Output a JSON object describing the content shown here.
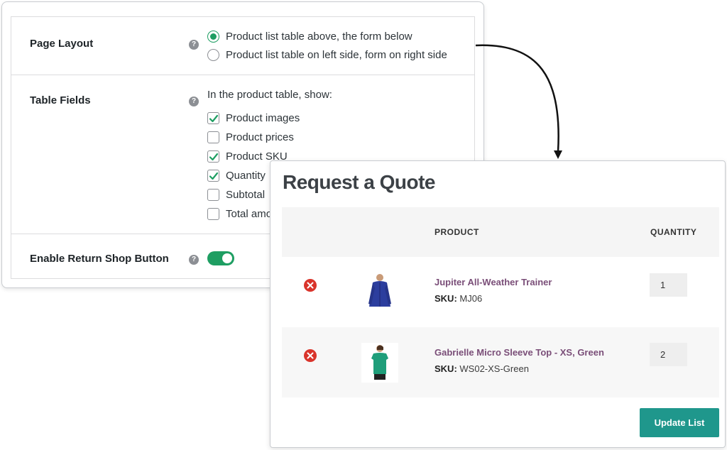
{
  "settings": {
    "page_layout": {
      "label": "Page Layout",
      "options": [
        {
          "label": "Product list table above, the form below",
          "selected": true
        },
        {
          "label": "Product list table on left side, form on right side",
          "selected": false
        }
      ]
    },
    "table_fields": {
      "label": "Table Fields",
      "intro": "In the product table, show:",
      "options": [
        {
          "label": "Product images",
          "checked": true
        },
        {
          "label": "Product prices",
          "checked": false
        },
        {
          "label": "Product SKU",
          "checked": true
        },
        {
          "label": "Quantity",
          "checked": true
        },
        {
          "label": "Subtotal",
          "checked": false
        },
        {
          "label": "Total amo",
          "checked": false
        }
      ]
    },
    "return_shop": {
      "label": "Enable Return Shop Button",
      "enabled": true
    },
    "help_glyph": "?"
  },
  "quote": {
    "title": "Request a Quote",
    "columns": {
      "product": "PRODUCT",
      "quantity": "QUANTITY"
    },
    "sku_label": "SKU:",
    "items": [
      {
        "name": "Jupiter All-Weather Trainer",
        "sku": "MJ06",
        "quantity": "1",
        "image_icon": "blue-jacket-thumbnail"
      },
      {
        "name": "Gabrielle Micro Sleeve Top - XS, Green",
        "sku": "WS02-XS-Green",
        "quantity": "2",
        "image_icon": "green-top-thumbnail"
      }
    ],
    "update_button": "Update List"
  },
  "colors": {
    "accent_green": "#1e9e62",
    "button_teal": "#1f978c",
    "product_link": "#7a4e78",
    "remove_red": "#d9342b"
  }
}
